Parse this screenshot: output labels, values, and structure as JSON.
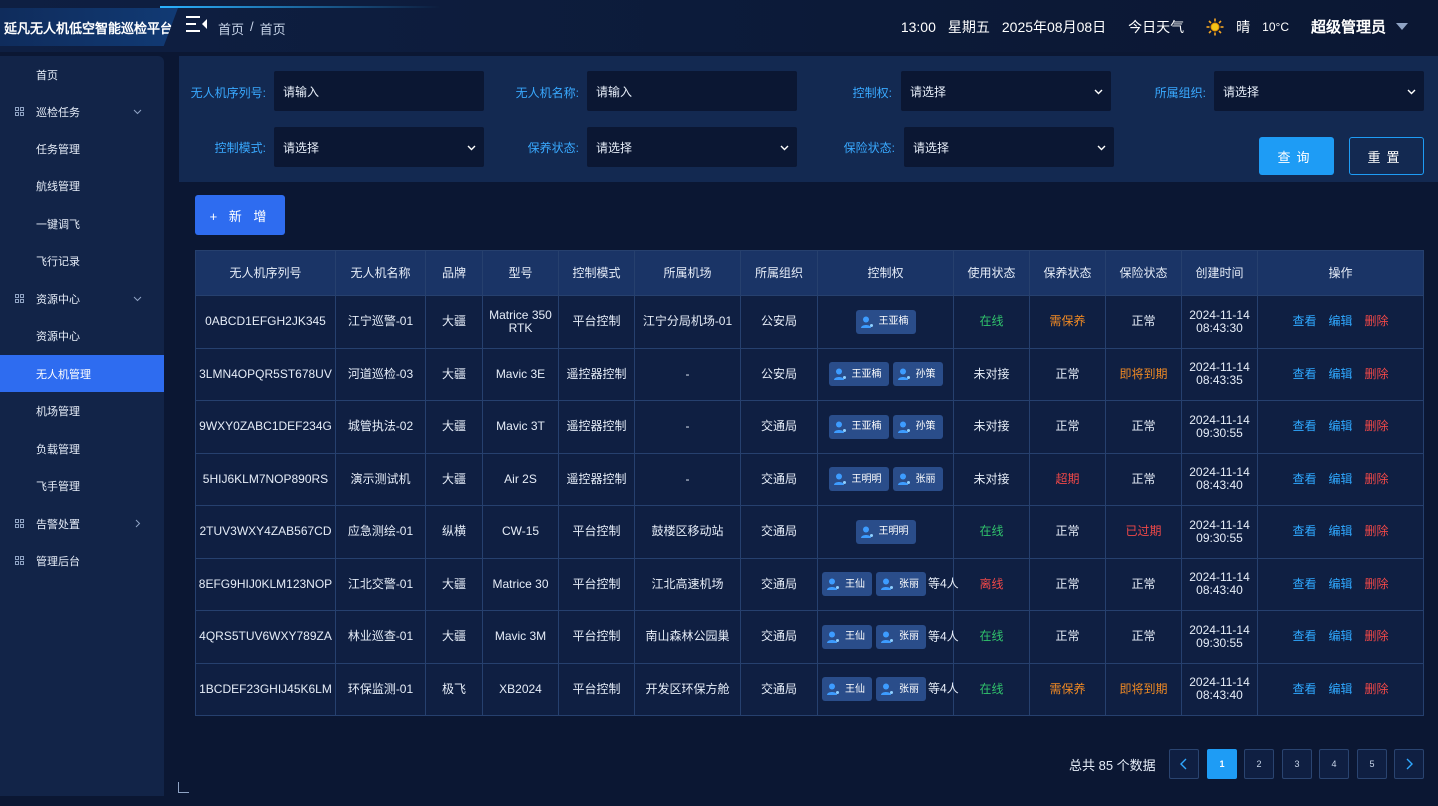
{
  "app": {
    "title": "延凡无人机低空智能巡检平台"
  },
  "header": {
    "breadcrumb": [
      "首页",
      "/",
      "首页"
    ],
    "time": "13:00",
    "weekday": "星期五",
    "date": "2025年08月08日",
    "weather_label": "今日天气",
    "weather": "晴",
    "temperature": "10°C",
    "user": "超级管理员",
    "icons": [
      "menu-toggle-icon",
      "sun-icon",
      "caret-down-icon"
    ]
  },
  "sidebar": {
    "items": [
      {
        "label": "首页",
        "type": "child"
      },
      {
        "label": "巡检任务",
        "type": "parent",
        "chevron": "down"
      },
      {
        "label": "任务管理",
        "type": "child"
      },
      {
        "label": "航线管理",
        "type": "child"
      },
      {
        "label": "一键调飞",
        "type": "child"
      },
      {
        "label": "飞行记录",
        "type": "child"
      },
      {
        "label": "资源中心",
        "type": "parent",
        "chevron": "down"
      },
      {
        "label": "资源中心",
        "type": "child"
      },
      {
        "label": "无人机管理",
        "type": "child",
        "active": true
      },
      {
        "label": "机场管理",
        "type": "child"
      },
      {
        "label": "负载管理",
        "type": "child"
      },
      {
        "label": "飞手管理",
        "type": "child"
      },
      {
        "label": "告警处置",
        "type": "parent",
        "chevron": "right"
      },
      {
        "label": "管理后台",
        "type": "parent"
      }
    ]
  },
  "filters": {
    "serial_label": "无人机序列号:",
    "serial_placeholder": "请输入",
    "name_label": "无人机名称:",
    "name_placeholder": "请输入",
    "control_label": "控制权:",
    "control_value": "请选择",
    "org_label": "所属组织:",
    "org_value": "请选择",
    "mode_label": "控制模式:",
    "mode_value": "请选择",
    "maint_label": "保养状态:",
    "maint_value": "请选择",
    "insure_label": "保险状态:",
    "insure_value": "请选择",
    "query_button": "查询",
    "reset_button": "重置"
  },
  "toolbar": {
    "add_button": "+ 新 增"
  },
  "table": {
    "columns": [
      "无人机序列号",
      "无人机名称",
      "品牌",
      "型号",
      "控制模式",
      "所属机场",
      "所属组织",
      "控制权",
      "使用状态",
      "保养状态",
      "保险状态",
      "创建时间",
      "操作"
    ],
    "actions": {
      "view": "查看",
      "edit": "编辑",
      "delete": "删除"
    },
    "rows": [
      {
        "serial": "0ABCD1EFGH2JK345",
        "name": "江宁巡警-01",
        "brand": "大疆",
        "model": "Matrice 350 RTK",
        "mode": "平台控制",
        "airport": "江宁分局机场-01",
        "org": "公安局",
        "control": [
          "王亚楠"
        ],
        "control_more": "",
        "usage": "在线",
        "usage_color": "green",
        "maint": "需保养",
        "maint_color": "orange",
        "insure": "正常",
        "insure_color": "white",
        "created_date": "2024-11-14",
        "created_time": "08:43:30"
      },
      {
        "serial": "3LMN4OPQR5ST678UV",
        "name": "河道巡检-03",
        "brand": "大疆",
        "model": "Mavic 3E",
        "mode": "遥控器控制",
        "airport": "-",
        "org": "公安局",
        "control": [
          "王亚楠",
          "孙策"
        ],
        "control_more": "",
        "usage": "未对接",
        "usage_color": "white",
        "maint": "正常",
        "maint_color": "white",
        "insure": "即将到期",
        "insure_color": "orange",
        "created_date": "2024-11-14",
        "created_time": "08:43:35"
      },
      {
        "serial": "9WXY0ZABC1DEF234G",
        "name": "城管执法-02",
        "brand": "大疆",
        "model": "Mavic 3T",
        "mode": "遥控器控制",
        "airport": "-",
        "org": "交通局",
        "control": [
          "王亚楠",
          "孙策"
        ],
        "control_more": "",
        "usage": "未对接",
        "usage_color": "white",
        "maint": "正常",
        "maint_color": "white",
        "insure": "正常",
        "insure_color": "white",
        "created_date": "2024-11-14",
        "created_time": "09:30:55"
      },
      {
        "serial": "5HIJ6KLM7NOP890RS",
        "name": "演示测试机",
        "brand": "大疆",
        "model": "Air 2S",
        "mode": "遥控器控制",
        "airport": "-",
        "org": "交通局",
        "control": [
          "王明明",
          "张丽"
        ],
        "control_more": "",
        "usage": "未对接",
        "usage_color": "white",
        "maint": "超期",
        "maint_color": "red",
        "insure": "正常",
        "insure_color": "white",
        "created_date": "2024-11-14",
        "created_time": "08:43:40"
      },
      {
        "serial": "2TUV3WXY4ZAB567CD",
        "name": "应急测绘-01",
        "brand": "纵横",
        "model": "CW-15",
        "mode": "平台控制",
        "airport": "鼓楼区移动站",
        "org": "交通局",
        "control": [
          "王明明"
        ],
        "control_more": "",
        "usage": "在线",
        "usage_color": "green",
        "maint": "正常",
        "maint_color": "white",
        "insure": "已过期",
        "insure_color": "red",
        "created_date": "2024-11-14",
        "created_time": "09:30:55"
      },
      {
        "serial": "8EFG9HIJ0KLM123NOP",
        "name": "江北交警-01",
        "brand": "大疆",
        "model": "Matrice 30",
        "mode": "平台控制",
        "airport": "江北高速机场",
        "org": "交通局",
        "control": [
          "王仙",
          "张丽"
        ],
        "control_more": "等4人",
        "usage": "离线",
        "usage_color": "red",
        "maint": "正常",
        "maint_color": "white",
        "insure": "正常",
        "insure_color": "white",
        "created_date": "2024-11-14",
        "created_time": "08:43:40"
      },
      {
        "serial": "4QRS5TUV6WXY789ZA",
        "name": "林业巡查-01",
        "brand": "大疆",
        "model": "Mavic 3M",
        "mode": "平台控制",
        "airport": "南山森林公园巢",
        "org": "交通局",
        "control": [
          "王仙",
          "张丽"
        ],
        "control_more": "等4人",
        "usage": "在线",
        "usage_color": "green",
        "maint": "正常",
        "maint_color": "white",
        "insure": "正常",
        "insure_color": "white",
        "created_date": "2024-11-14",
        "created_time": "09:30:55"
      },
      {
        "serial": "1BCDEF23GHIJ45K6LM",
        "name": "环保监测-01",
        "brand": "极飞",
        "model": "XB2024",
        "mode": "平台控制",
        "airport": "开发区环保方舱",
        "org": "交通局",
        "control": [
          "王仙",
          "张丽"
        ],
        "control_more": "等4人",
        "usage": "在线",
        "usage_color": "green",
        "maint": "需保养",
        "maint_color": "orange",
        "insure": "即将到期",
        "insure_color": "orange",
        "created_date": "2024-11-14",
        "created_time": "08:43:40"
      }
    ]
  },
  "pagination": {
    "total_text": "总共 85 个数据",
    "pages": [
      "1",
      "2",
      "3",
      "4",
      "5"
    ],
    "current": "1",
    "prev_icon": "chevron-left-icon",
    "next_icon": "chevron-right-icon"
  },
  "colors": {
    "accent": "#2e6cf0",
    "label": "#39a9ff",
    "green": "#30c26b",
    "orange": "#f08a24",
    "red": "#f04848"
  }
}
